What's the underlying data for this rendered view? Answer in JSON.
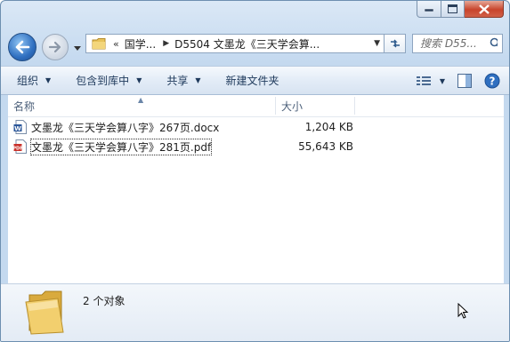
{
  "address_bar": {
    "overflow": "«",
    "crumbs": [
      "国学...",
      "D5504 文墨龙《三天学会算..."
    ]
  },
  "search": {
    "placeholder": "搜索 D55..."
  },
  "toolbar": {
    "organize": "组织",
    "include_in_library": "包含到库中",
    "share": "共享",
    "new_folder": "新建文件夹"
  },
  "columns": {
    "name": "名称",
    "size": "大小"
  },
  "files": [
    {
      "name": "文墨龙《三天学会算八字》267页.docx",
      "size": "1,204 KB",
      "type": "docx"
    },
    {
      "name": "文墨龙《三天学会算八字》281页.pdf",
      "size": "55,643 KB",
      "type": "pdf"
    }
  ],
  "details": {
    "count_text": "2 个对象"
  },
  "icons": {
    "back": "back-arrow-icon",
    "forward": "forward-arrow-icon",
    "refresh": "refresh-icon",
    "search": "magnifier-icon",
    "view": "view-options-icon",
    "preview": "preview-pane-icon",
    "help": "help-icon"
  },
  "colors": {
    "chrome": "#c4d9ef",
    "accent_blue": "#2f6fc0",
    "toolbar_text": "#1e395b",
    "close_red": "#c8442c"
  }
}
